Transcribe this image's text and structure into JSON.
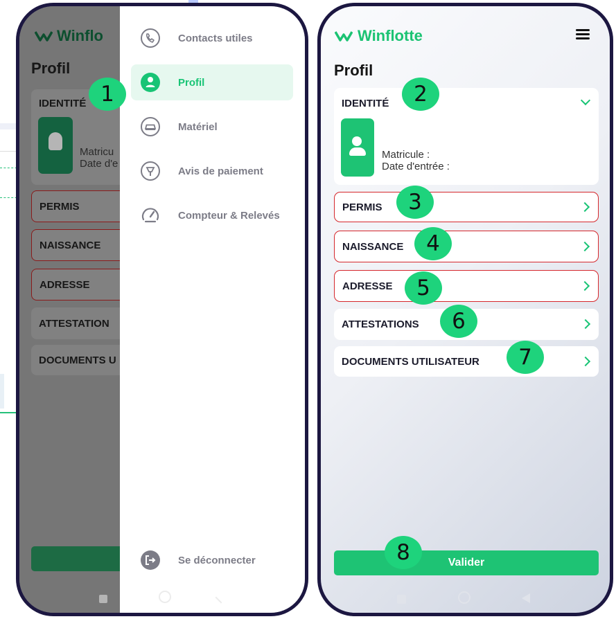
{
  "brand": {
    "name_left": "Winflo",
    "name_right": "Winflotte",
    "accent": "#1ec374",
    "frame": "#1c1741",
    "error": "#d5262b"
  },
  "left_phone": {
    "title": "Profil",
    "identity_label": "IDENTITÉ",
    "meta_line1": "Matricu",
    "meta_line2": "Date d'e",
    "sections": [
      "PERMIS",
      "NAISSANCE",
      "ADRESSE",
      "ATTESTATION",
      "DOCUMENTS U"
    ],
    "drawer": {
      "items": [
        {
          "label": "Contacts utiles",
          "icon": "phone-icon",
          "active": false
        },
        {
          "label": "Profil",
          "icon": "user-icon",
          "active": true
        },
        {
          "label": "Matériel",
          "icon": "car-icon",
          "active": false
        },
        {
          "label": "Avis de paiement",
          "icon": "fuel-nozzle-icon",
          "active": false
        },
        {
          "label": "Compteur & Relevés",
          "icon": "speedometer-icon",
          "active": false
        }
      ],
      "logout": {
        "label": "Se déconnecter",
        "icon": "logout-icon"
      }
    }
  },
  "right_phone": {
    "title": "Profil",
    "identity": {
      "label": "IDENTITÉ",
      "matricule_label": "Matricule :",
      "date_label": "Date d'entrée :"
    },
    "sections": [
      {
        "label": "PERMIS",
        "error": true
      },
      {
        "label": "NAISSANCE",
        "error": true
      },
      {
        "label": "ADRESSE",
        "error": true
      },
      {
        "label": "ATTESTATIONS",
        "error": false
      },
      {
        "label": "DOCUMENTS UTILISATEUR",
        "error": false
      }
    ],
    "submit_label": "Valider"
  },
  "badges": [
    "1",
    "2",
    "3",
    "4",
    "5",
    "6",
    "7",
    "8"
  ]
}
